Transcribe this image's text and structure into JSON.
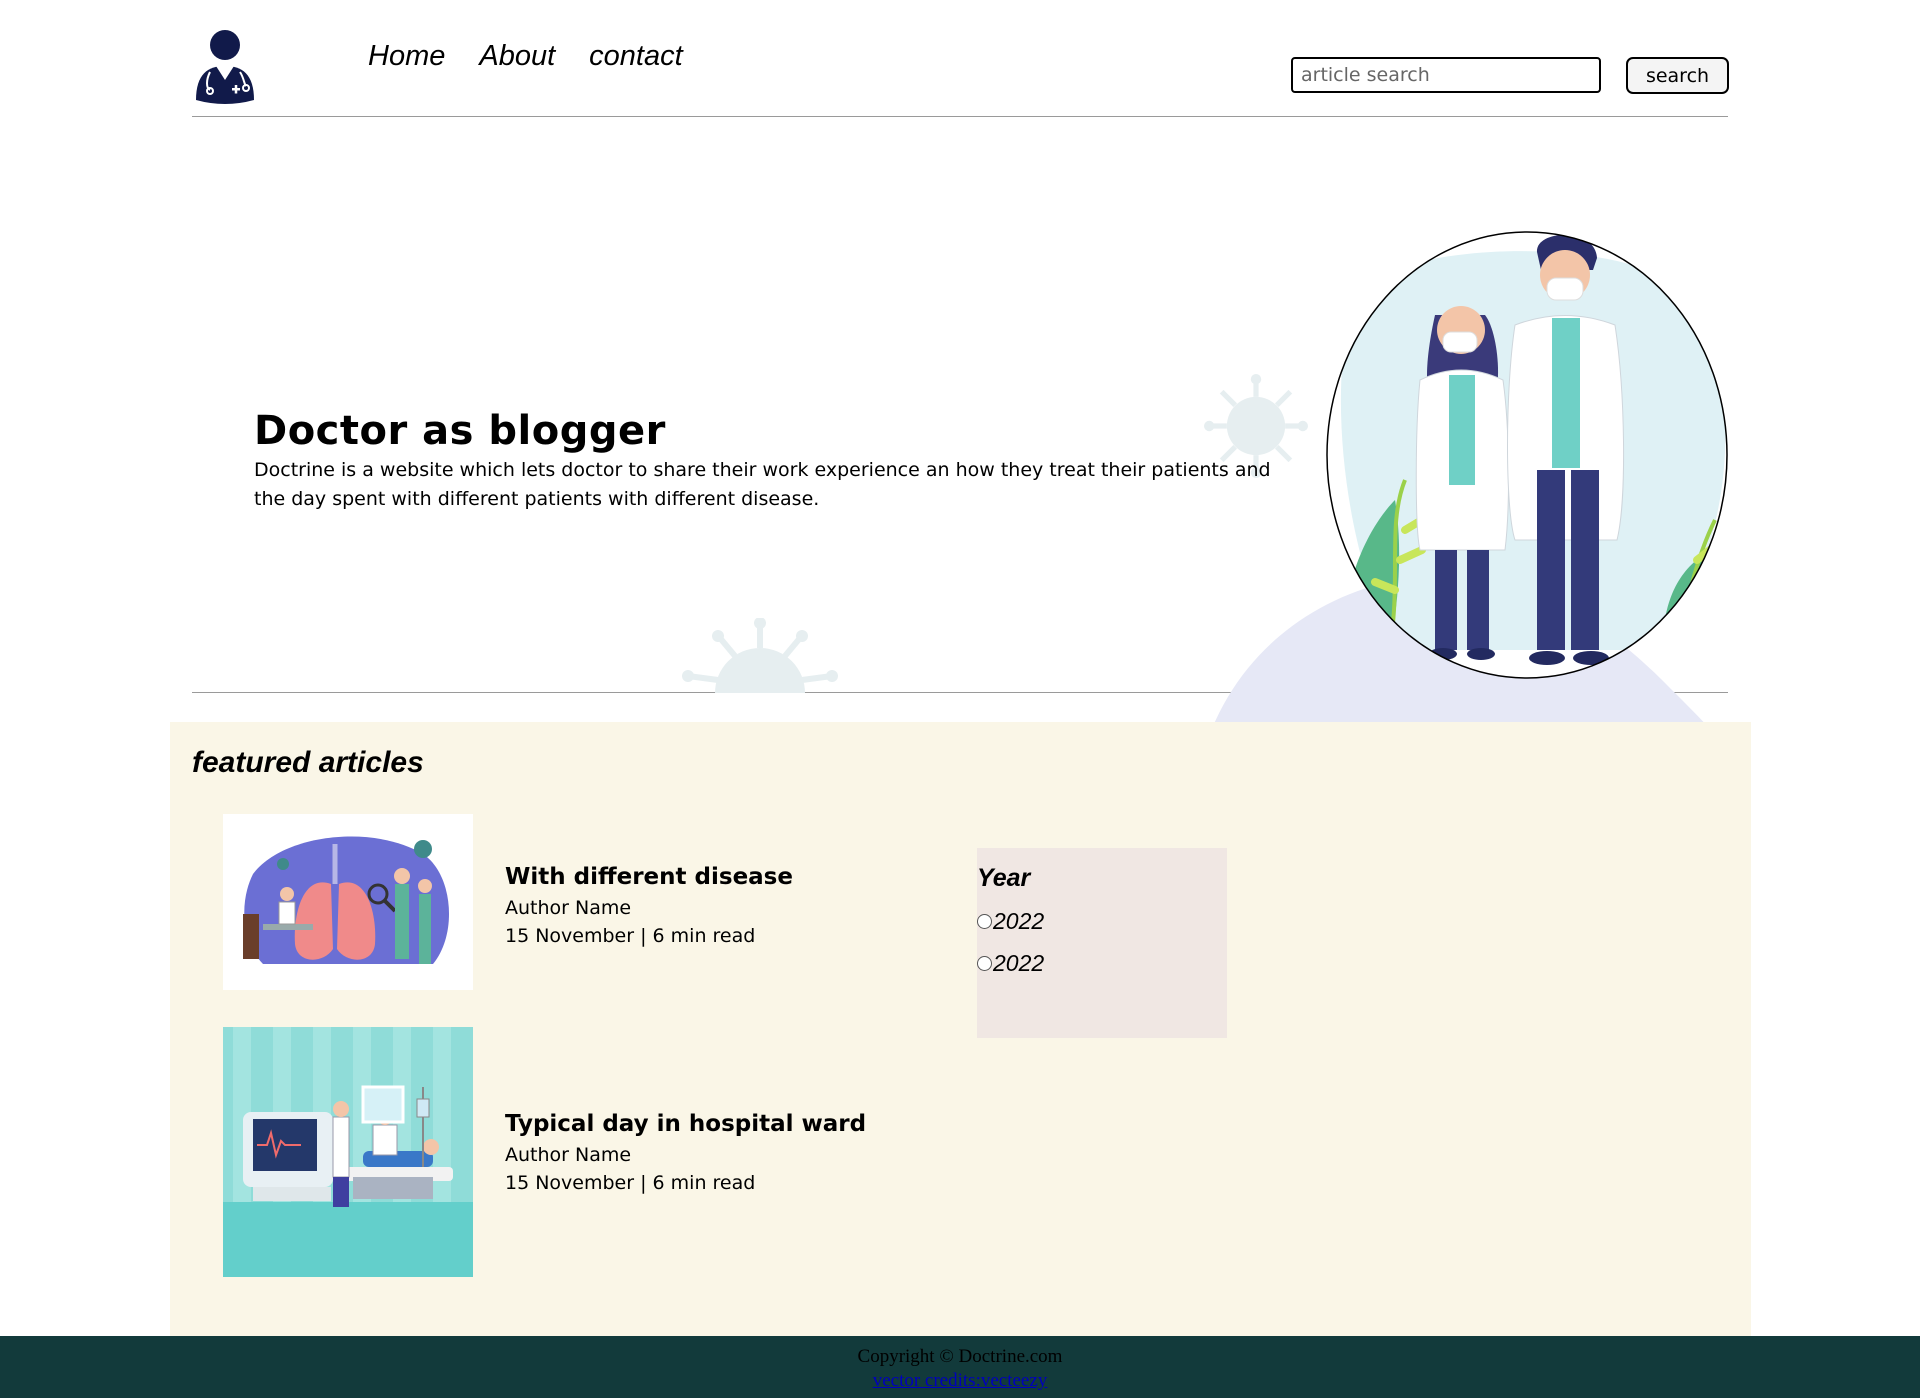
{
  "header": {
    "nav": [
      "Home",
      "About",
      "contact"
    ],
    "search_placeholder": "article search",
    "search_button": "search"
  },
  "hero": {
    "title": "Doctor as blogger",
    "description": "Doctrine is a website which lets doctor to share their work experience an how they treat their patients and the day spent with different patients with different disease."
  },
  "featured": {
    "title": "featured articles",
    "articles": [
      {
        "title": "With different disease",
        "author": "Author Name",
        "meta": "15 November | 6 min read"
      },
      {
        "title": "Typical day in hospital ward",
        "author": "Author Name",
        "meta": "15 November | 6 min read"
      }
    ],
    "filter": {
      "title": "Year",
      "options": [
        "2022",
        "2022"
      ]
    }
  },
  "footer": {
    "copyright": "Copyright © Doctrine.com",
    "credits": "vector credits:vecteezy"
  },
  "colors": {
    "featured_bg": "#faf6e7",
    "filter_bg": "#f0e7e3",
    "footer_bg": "#123a3b",
    "logo_navy": "#111a4a"
  }
}
